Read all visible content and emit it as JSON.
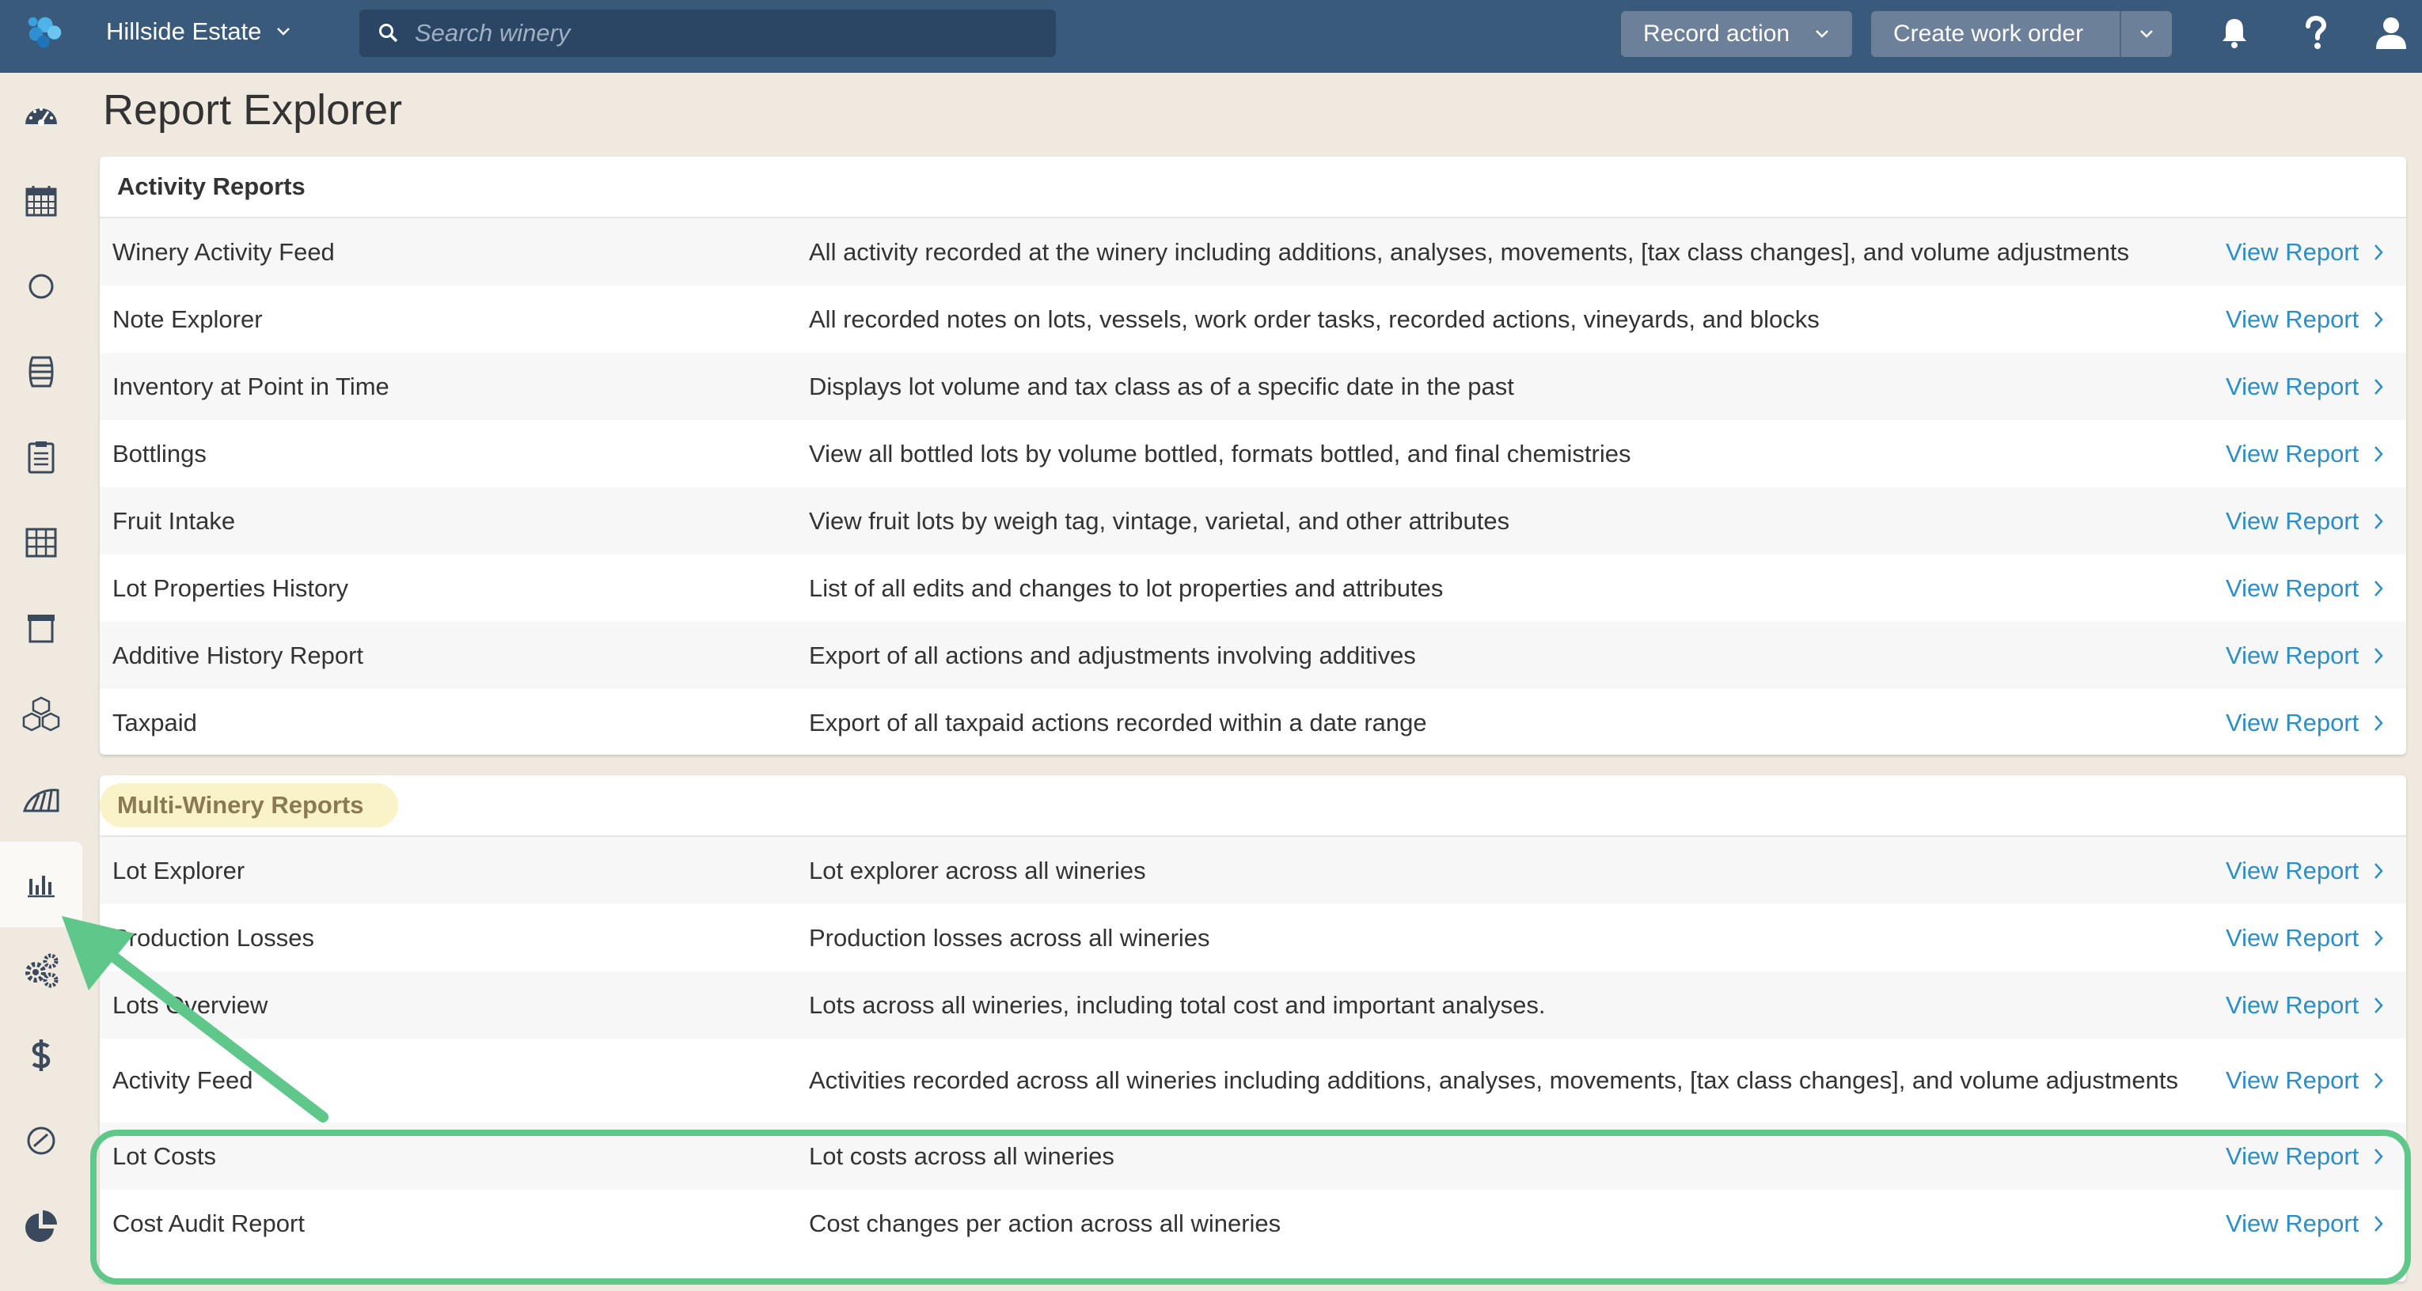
{
  "topbar": {
    "winery_name": "Hillside Estate",
    "search_placeholder": "Search winery",
    "record_action_label": "Record action",
    "create_work_order_label": "Create work order",
    "bg_color": "#3a5a7c"
  },
  "sidebar": {
    "items": [
      {
        "icon": "dashboard-icon"
      },
      {
        "icon": "calendar-icon"
      },
      {
        "icon": "circle-icon"
      },
      {
        "icon": "barrel-icon"
      },
      {
        "icon": "clipboard-icon"
      },
      {
        "icon": "grid-icon"
      },
      {
        "icon": "archive-icon"
      },
      {
        "icon": "cubes-icon"
      },
      {
        "icon": "vineyard-icon"
      },
      {
        "icon": "bar-chart-icon",
        "active": true
      },
      {
        "icon": "cogs-icon"
      },
      {
        "icon": "dollar-icon"
      },
      {
        "icon": "gauge-icon"
      },
      {
        "icon": "pie-chart-icon"
      }
    ]
  },
  "main": {
    "title": "Report Explorer",
    "activity": {
      "heading": "Activity Reports",
      "rows": [
        {
          "name": "Winery Activity Feed",
          "desc": "All activity recorded at the winery including additions, analyses, movements, [tax class changes], and volume adjustments",
          "link": "View Report"
        },
        {
          "name": "Note Explorer",
          "desc": "All recorded notes on lots, vessels, work order tasks, recorded actions, vineyards, and blocks",
          "link": "View Report"
        },
        {
          "name": "Inventory at Point in Time",
          "desc": "Displays lot volume and tax class as of a specific date in the past",
          "link": "View Report"
        },
        {
          "name": "Bottlings",
          "desc": "View all bottled lots by volume bottled, formats bottled, and final chemistries",
          "link": "View Report"
        },
        {
          "name": "Fruit Intake",
          "desc": "View fruit lots by weigh tag, vintage, varietal, and other attributes",
          "link": "View Report"
        },
        {
          "name": "Lot Properties History",
          "desc": "List of all edits and changes to lot properties and attributes",
          "link": "View Report"
        },
        {
          "name": "Additive History Report",
          "desc": "Export of all actions and adjustments involving additives",
          "link": "View Report"
        },
        {
          "name": "Taxpaid",
          "desc": "Export of all taxpaid actions recorded within a date range",
          "link": "View Report"
        }
      ]
    },
    "multi": {
      "heading": "Multi-Winery Reports",
      "rows": [
        {
          "name": "Lot Explorer",
          "desc": "Lot explorer across all wineries",
          "link": "View Report"
        },
        {
          "name": "Production Losses",
          "desc": "Production losses across all wineries",
          "link": "View Report"
        },
        {
          "name": "Lots Overview",
          "desc": "Lots across all wineries, including total cost and important analyses.",
          "link": "View Report"
        },
        {
          "name": "Activity Feed",
          "desc": "Activities recorded across all wineries including additions, analyses, movements, [tax class changes], and volume adjustments",
          "link": "View Report"
        },
        {
          "name": "Lot Costs",
          "desc": "Lot costs across all wineries",
          "link": "View Report"
        },
        {
          "name": "Cost Audit Report",
          "desc": "Cost changes per action across all wineries",
          "link": "View Report"
        }
      ]
    }
  },
  "colors": {
    "link": "#2a8ec9",
    "annotation_green": "#5fc78a",
    "highlight_yellow": "#fbf3c8"
  }
}
